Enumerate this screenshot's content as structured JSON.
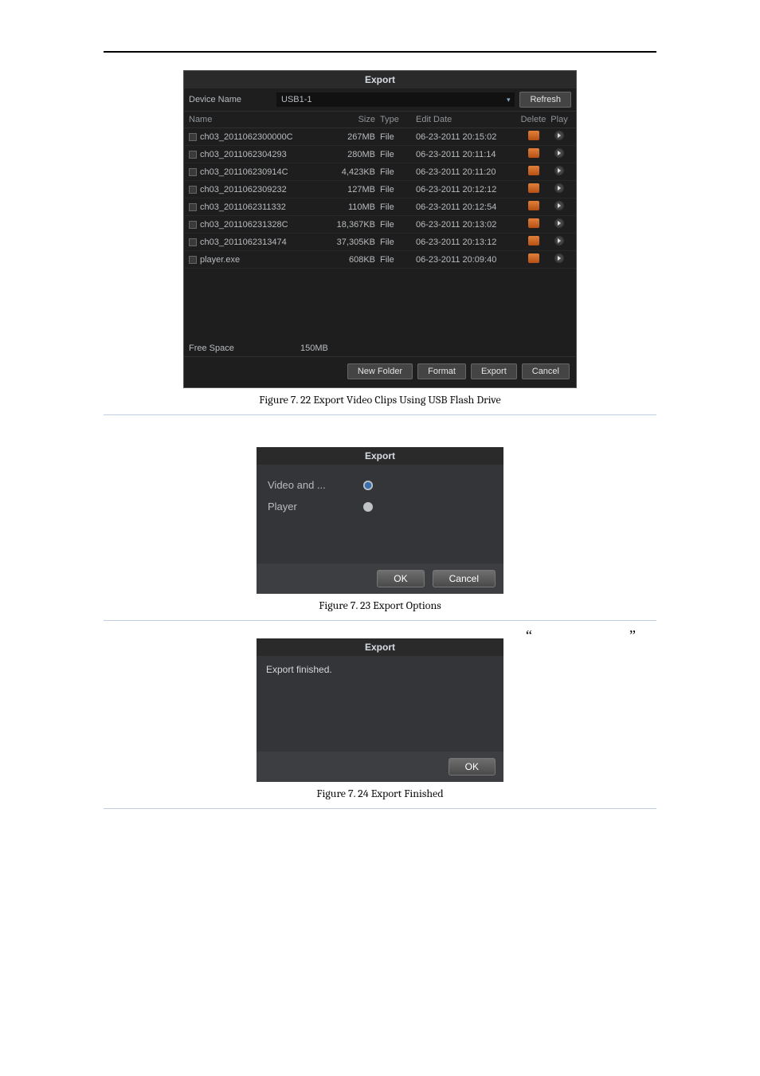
{
  "captions": {
    "fig1": "Figure 7. 22 Export Video Clips Using USB Flash Drive",
    "fig2": "Figure 7. 23 Export Options",
    "fig3": "Figure 7. 24 Export Finished"
  },
  "dialog1": {
    "title": "Export",
    "device_label": "Device Name",
    "device_value": "USB1-1",
    "refresh": "Refresh",
    "columns": {
      "name": "Name",
      "size": "Size",
      "type": "Type",
      "edit_date": "Edit Date",
      "delete": "Delete",
      "play": "Play"
    },
    "files": [
      {
        "name": "ch03_2011062300000C",
        "size": "267MB",
        "type": "File",
        "date": "06-23-2011 20:15:02"
      },
      {
        "name": "ch03_2011062304293",
        "size": "280MB",
        "type": "File",
        "date": "06-23-2011 20:11:14"
      },
      {
        "name": "ch03_201106230914C",
        "size": "4,423KB",
        "type": "File",
        "date": "06-23-2011 20:11:20"
      },
      {
        "name": "ch03_2011062309232",
        "size": "127MB",
        "type": "File",
        "date": "06-23-2011 20:12:12"
      },
      {
        "name": "ch03_2011062311332",
        "size": "110MB",
        "type": "File",
        "date": "06-23-2011 20:12:54"
      },
      {
        "name": "ch03_201106231328C",
        "size": "18,367KB",
        "type": "File",
        "date": "06-23-2011 20:13:02"
      },
      {
        "name": "ch03_2011062313474",
        "size": "37,305KB",
        "type": "File",
        "date": "06-23-2011 20:13:12"
      },
      {
        "name": "player.exe",
        "size": "608KB",
        "type": "File",
        "date": "06-23-2011 20:09:40"
      }
    ],
    "free_space_label": "Free Space",
    "free_space_value": "150MB",
    "buttons": {
      "new_folder": "New Folder",
      "format": "Format",
      "export": "Export",
      "cancel": "Cancel"
    }
  },
  "dialog2": {
    "title": "Export",
    "options": [
      {
        "label": "Video and ...",
        "selected": true
      },
      {
        "label": "Player",
        "selected": false
      }
    ],
    "ok": "OK",
    "cancel": "Cancel"
  },
  "dialog3": {
    "title": "Export",
    "message": "Export finished.",
    "ok": "OK",
    "quote_left": "“",
    "quote_right": "”"
  }
}
